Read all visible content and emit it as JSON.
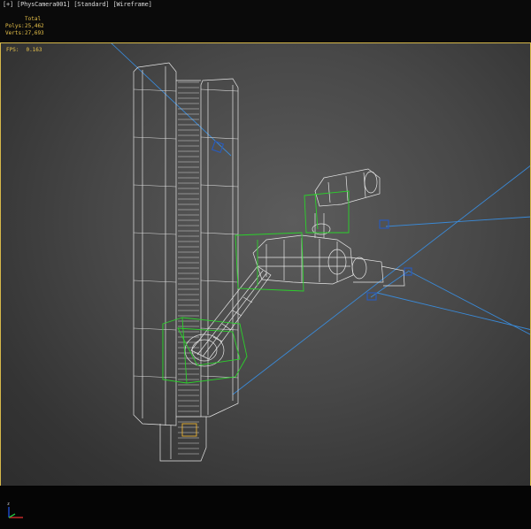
{
  "viewport": {
    "label": "[+] [PhysCamera001] [Standard] [Wireframe]",
    "accent_color": "#d6b84a"
  },
  "stats": {
    "header": "Total",
    "polys_label": "Polys:",
    "polys_value": "25,462",
    "verts_label": "Verts:",
    "verts_value": "27,693"
  },
  "fps": {
    "label": "FPS:",
    "value": "0.163"
  },
  "gizmo": {
    "icon": "axis-gizmo-icon",
    "axes": [
      "x",
      "y",
      "z"
    ]
  },
  "colors": {
    "wire": "#e6e6e6",
    "selection": "#2bd22b",
    "light_lines": "#3a8ad8"
  }
}
